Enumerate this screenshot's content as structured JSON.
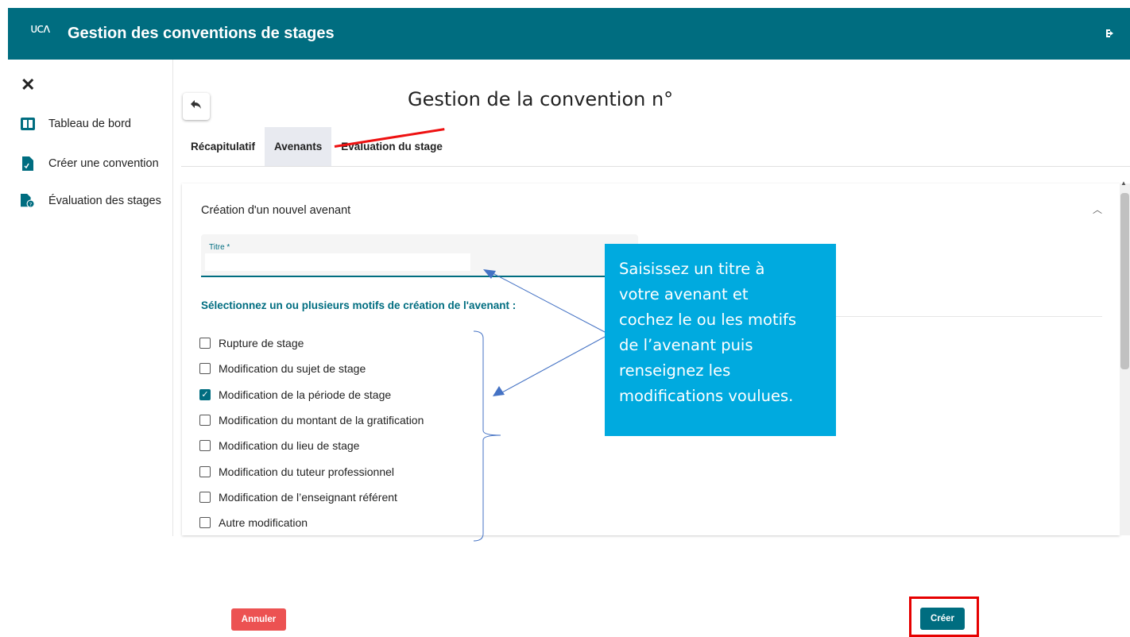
{
  "header": {
    "logo_text": "ᴜᴄᴧ",
    "title": "Gestion des conventions de stages",
    "logout_icon": "logout-icon"
  },
  "sidebar": {
    "close_icon": "close-icon",
    "items": [
      {
        "label": "Tableau de bord",
        "icon": "dashboard-icon"
      },
      {
        "label": "Créer une convention",
        "icon": "document-icon"
      },
      {
        "label": "Évaluation des stages",
        "icon": "evaluation-icon"
      }
    ]
  },
  "main": {
    "page_title": "Gestion de la convention n°",
    "back_icon": "undo-arrow-icon",
    "tabs": [
      {
        "label": "Récapitulatif",
        "active": false
      },
      {
        "label": "Avenants",
        "active": true
      },
      {
        "label": "Evaluation du stage",
        "active": false
      }
    ],
    "panel": {
      "title": "Création d'un nouvel avenant",
      "title_field_label": "Titre *",
      "title_field_value": "",
      "motifs_heading": "Sélectionnez un ou plusieurs motifs de création de l'avenant :",
      "options": [
        {
          "label": "Rupture de stage",
          "checked": false
        },
        {
          "label": "Modification du sujet de stage",
          "checked": false
        },
        {
          "label": "Modification de la période de stage",
          "checked": true
        },
        {
          "label": "Modification du montant de la gratification",
          "checked": false
        },
        {
          "label": "Modification du lieu de stage",
          "checked": false
        },
        {
          "label": "Modification du tuteur professionnel",
          "checked": false
        },
        {
          "label": "Modification de l’enseignant référent",
          "checked": false
        },
        {
          "label": "Autre modification",
          "checked": false
        }
      ]
    }
  },
  "callout": {
    "lines": [
      "Saisissez un titre à",
      "votre avenant et",
      "cochez le ou les motifs",
      "de l’avenant puis",
      "renseignez les",
      "modifications voulues."
    ]
  },
  "footer": {
    "cancel_label": "Annuler",
    "create_label": "Créer"
  },
  "colors": {
    "primary": "#006d80",
    "callout": "#00aadf",
    "cancel": "#ec5252",
    "highlight": "#e60000"
  }
}
